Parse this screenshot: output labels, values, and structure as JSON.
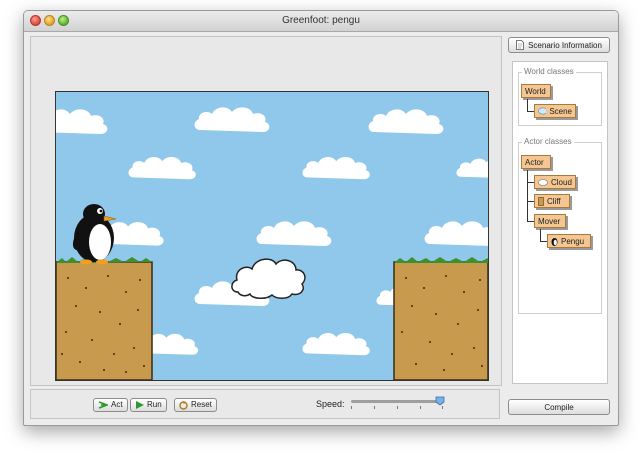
{
  "window": {
    "title": "Greenfoot: pengu"
  },
  "right_panel": {
    "scenario_info_label": "Scenario Information",
    "compile_label": "Compile"
  },
  "world_classes": {
    "title": "World classes",
    "items": [
      {
        "label": "World"
      },
      {
        "label": "Scene"
      }
    ]
  },
  "actor_classes": {
    "title": "Actor classes",
    "items": [
      {
        "label": "Actor"
      },
      {
        "label": "Cloud"
      },
      {
        "label": "Cliff"
      },
      {
        "label": "Mover"
      },
      {
        "label": "Pengu"
      }
    ]
  },
  "controls": {
    "act_label": "Act",
    "run_label": "Run",
    "reset_label": "Reset",
    "speed_label": "Speed:",
    "speed_level_fraction": 0.9
  },
  "colors": {
    "sky": "#8fc8ea",
    "cliff": "#c79a4d",
    "class_box": "#f4c691",
    "run_arrow": "#2e9a2e"
  },
  "icons": {
    "act": "step-arrow-icon",
    "run": "play-icon",
    "reset": "reset-icon",
    "scenario_info": "document-icon"
  }
}
